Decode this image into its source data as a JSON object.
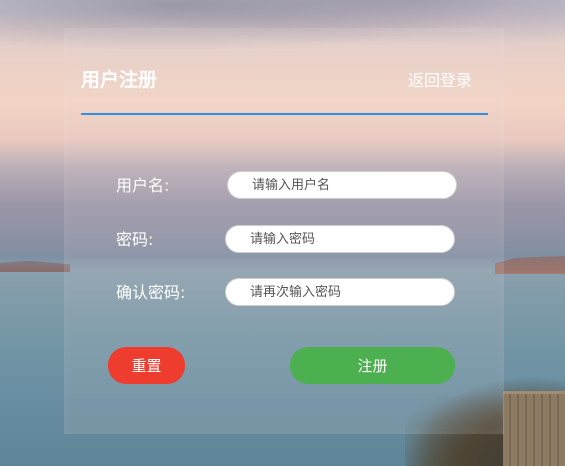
{
  "header": {
    "title": "用户注册",
    "back_link": "返回登录"
  },
  "form": {
    "username": {
      "label": "用户名:",
      "placeholder": "请输入用户名",
      "value": ""
    },
    "password": {
      "label": "密码:",
      "placeholder": "请输入密码",
      "value": ""
    },
    "confirm_password": {
      "label": "确认密码:",
      "placeholder": "请再次输入密码",
      "value": ""
    }
  },
  "buttons": {
    "reset": "重置",
    "submit": "注册"
  },
  "colors": {
    "accent_line": "#2f8fe0",
    "reset_button": "#ee3c2f",
    "submit_button": "#4caf50"
  }
}
